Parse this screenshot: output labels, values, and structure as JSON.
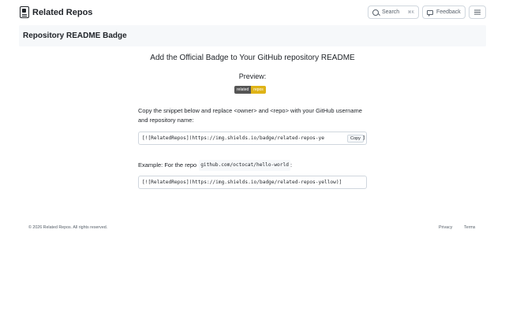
{
  "header": {
    "brand_name": "Related Repos",
    "search_label": "Search",
    "search_shortcut": "⌘K",
    "feedback_label": "Feedback"
  },
  "page": {
    "title": "Repository README Badge"
  },
  "main": {
    "headline": "Add the Official Badge to Your GitHub repository README",
    "preview_label": "Preview:",
    "badge": {
      "left_text": "related",
      "right_text": "repos",
      "left_color": "#555555",
      "right_color": "#dfb317"
    },
    "instructions": "Copy the snippet below and replace <owner> and <repo> with your GitHub username and repository name:",
    "snippet_visible": "[![RelatedRepos](https://img.shields.io/badge/related-repos-ye",
    "snippet_tail": "]",
    "copy_label": "Copy",
    "example_prefix": "Example: For the repo",
    "example_repo": "github.com/octocat/hello-world",
    "example_suffix": ":",
    "example_snippet": "[![RelatedRepos](https://img.shields.io/badge/related-repos-yellow)]"
  },
  "footer": {
    "copyright": "© 2026 Related Repos. All rights reserved.",
    "privacy": "Privacy",
    "terms": "Terms"
  }
}
